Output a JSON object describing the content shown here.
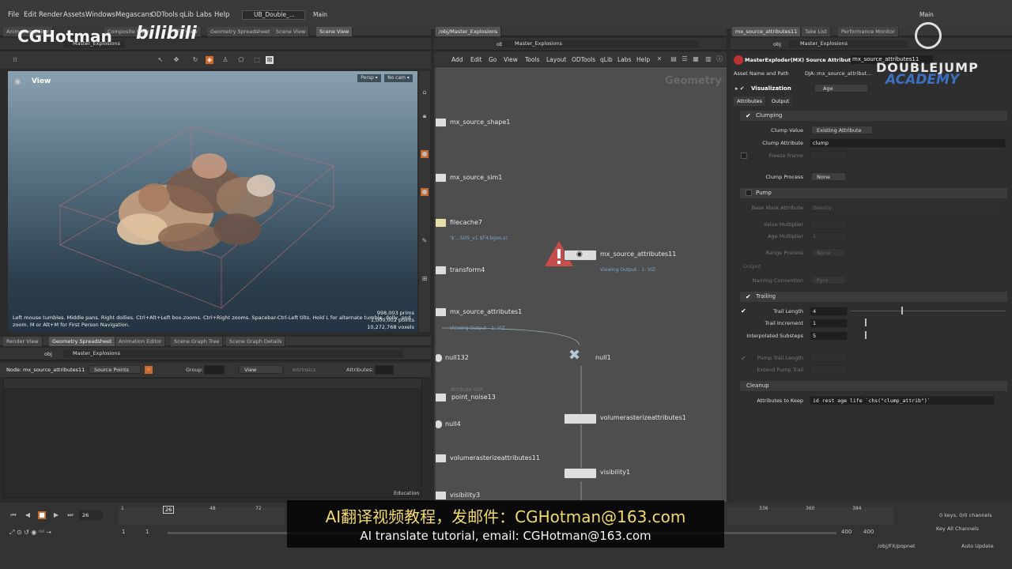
{
  "menubar": {
    "items": [
      "File",
      "Edit",
      "Render",
      "Assets",
      "Windows",
      "Megascans",
      "ODTools",
      "qLib",
      "Labs",
      "Help"
    ],
    "desktop_tab": "UB_Double_...",
    "main_label": "Main",
    "main_label_right": "Main"
  },
  "watermark": {
    "left_text": "CGHotman",
    "left_logo": "bilibili",
    "right_text": "DOUBLEJUMP",
    "right_sub": "ACADEMY"
  },
  "viewer": {
    "tabs": [
      "Animation Editor",
      "Composite View",
      "FX View",
      "Geometry Spreadsheet",
      "Scene View",
      "Scene View"
    ],
    "path_obj": "obj",
    "path_geo": "Master_Explosions",
    "title": "View",
    "persp_btn": "Persp ▾",
    "cam_btn": "No cam ▾",
    "help_text_1": "Left mouse tumbles. Middle pans. Right dollies. Ctrl+Alt+Left box-zooms. Ctrl+Right zooms. Spacebar-Ctrl-Left tilts. Hold L for alternate tumble, dolly, and",
    "help_text_2": "zoom. M or Alt+M for First Person Navigation.",
    "stats": [
      "998,003  prims",
      "1,000,002 points",
      "10,272,768 voxels"
    ]
  },
  "spreadsheet": {
    "tabs": [
      "Render View",
      "Geometry Spreadsheet",
      "Animation Editor",
      "Scene Graph Tree",
      "Scene Graph Details"
    ],
    "path_obj": "obj",
    "path_geo": "Master_Explosions",
    "node_label": "Node:",
    "node_value": "mx_source_attributes11",
    "mode": "Source Points",
    "group_label": "Group:",
    "view_label": "View",
    "intrinsics_label": "Intrinsics",
    "attributes_label": "Attributes:",
    "edition": "Education"
  },
  "network": {
    "tab": "/obj/Master_Explosions",
    "path_obj": "obj",
    "path_geo": "Master_Explosions",
    "menu": [
      "Add",
      "Edit",
      "Go",
      "View",
      "Tools",
      "Layout",
      "ODTools",
      "qLib",
      "Labs",
      "Help"
    ],
    "context_label": "Geometry",
    "nodes": [
      {
        "name": "mx_source_shape1"
      },
      {
        "name": "mx_source_sim1"
      },
      {
        "name": "filecache7",
        "sub": "'$'...SOS_v1.$F4.bgeo.sc"
      },
      {
        "name": "transform4"
      },
      {
        "name": "mx_source_attributes1",
        "sub": "Viewing Output - 1: VIZ"
      },
      {
        "name": "null132"
      },
      {
        "name": "point_noise13",
        "pre": "Attribute VOP"
      },
      {
        "name": "null4"
      },
      {
        "name": "volumerasterizeattributes11"
      },
      {
        "name": "visibility3"
      },
      {
        "name": "mx_source_attributes11",
        "sub": "Viewing Output - 1: VIZ"
      },
      {
        "name": "null1"
      },
      {
        "name": "volumerasterizeattributes1"
      },
      {
        "name": "visibility1"
      }
    ]
  },
  "params": {
    "tabs": [
      "mx_source_attributes11",
      "Take List",
      "Performance Monitor"
    ],
    "path_obj": "obj",
    "path_geo": "Master_Explosions",
    "node_type": "MasterExploder(MX) Source Attributes",
    "node_name": "mx_source_attributes11",
    "asset_label": "Asset Name and Path",
    "asset_value": "DJA::mx_source_attribut...",
    "visualization_label": "Visualization",
    "visualization_value": "Age",
    "subtabs": [
      "Attributes",
      "Output"
    ],
    "clumping": {
      "title": "Clumping",
      "clump_value_label": "Clump Value",
      "clump_value": "Existing Attribute",
      "clump_attr_label": "Clump Attribute",
      "clump_attr": "clump",
      "freeze_label": "Freeze Frame",
      "process_label": "Clump Process",
      "process_value": "None"
    },
    "pump": {
      "title": "Pump",
      "base_mask_label": "Base Mask Attribute",
      "base_mask_value": "density",
      "value_mult_label": "Value Multiplier",
      "age_mult_label": "Age Multiplier",
      "age_mult_value": "1",
      "range_label": "Range Process",
      "range_value": "None",
      "output_label": "Output",
      "naming_label": "Naming Convention",
      "naming_value": "Pyro"
    },
    "trailing": {
      "title": "Trailing",
      "length_label": "Trail Length",
      "length_value": "4",
      "increment_label": "Trail Increment",
      "increment_value": "1",
      "substeps_label": "Interpolated Substeps",
      "substeps_value": "5",
      "pump_length_label": "Pump Trail Length",
      "extend_label": "Extend Pump Trail"
    },
    "cleanup": {
      "title": "Cleanup",
      "keep_label": "Attributes to Keep",
      "keep_value": "id rest age life `chs(\"clump_attrib\")`"
    }
  },
  "timeline": {
    "frame": "26",
    "start": "1",
    "start2": "1",
    "ticks": [
      "1",
      "26",
      "48",
      "72",
      "336",
      "360",
      "384"
    ],
    "end": "400",
    "end2": "400",
    "keys_info": "0 keys, 0/0 channels",
    "key_all": "Key All Channels",
    "path": "/obj/FX/popnet",
    "update": "Auto Update"
  },
  "subtitle": {
    "cn": "AI翻译视频教程，发邮件：CGHotman@163.com",
    "en": "AI translate tutorial, email: CGHotman@163.com"
  }
}
